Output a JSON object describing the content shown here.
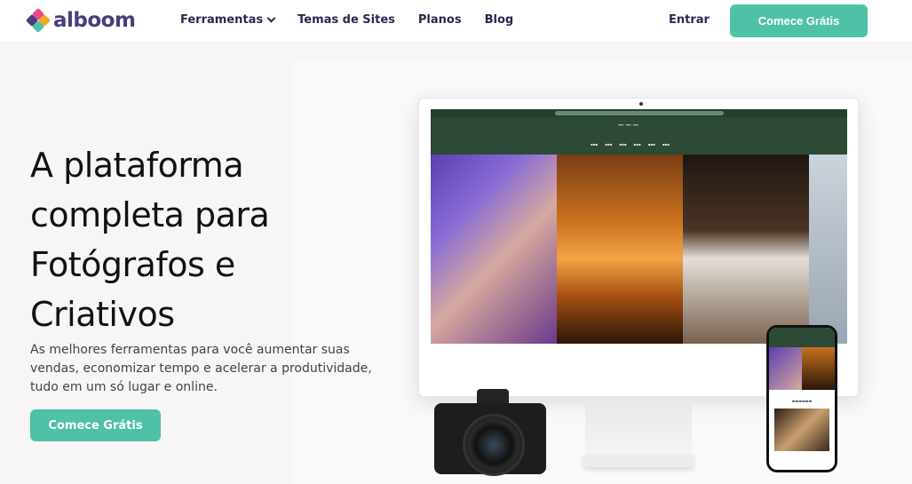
{
  "header": {
    "logo_text": "alboom",
    "nav": [
      {
        "label": "Ferramentas",
        "has_dropdown": true
      },
      {
        "label": "Temas de Sites"
      },
      {
        "label": "Planos"
      },
      {
        "label": "Blog"
      }
    ],
    "login_label": "Entrar",
    "cta_label": "Comece Grátis"
  },
  "hero": {
    "title_lines": [
      "A plataforma",
      "completa para",
      "Fotógrafos e",
      "Criativos"
    ],
    "subtitle": "As melhores ferramentas para você aumentar suas vendas, economizar tempo e acelerar a produtividade, tudo em um só lugar e online.",
    "cta_label": "Comece Grátis"
  },
  "colors": {
    "accent": "#4fc1a7",
    "brand_text": "#4a3d7c",
    "nav_text": "#2d2650",
    "site_green": "#2c4a35"
  }
}
